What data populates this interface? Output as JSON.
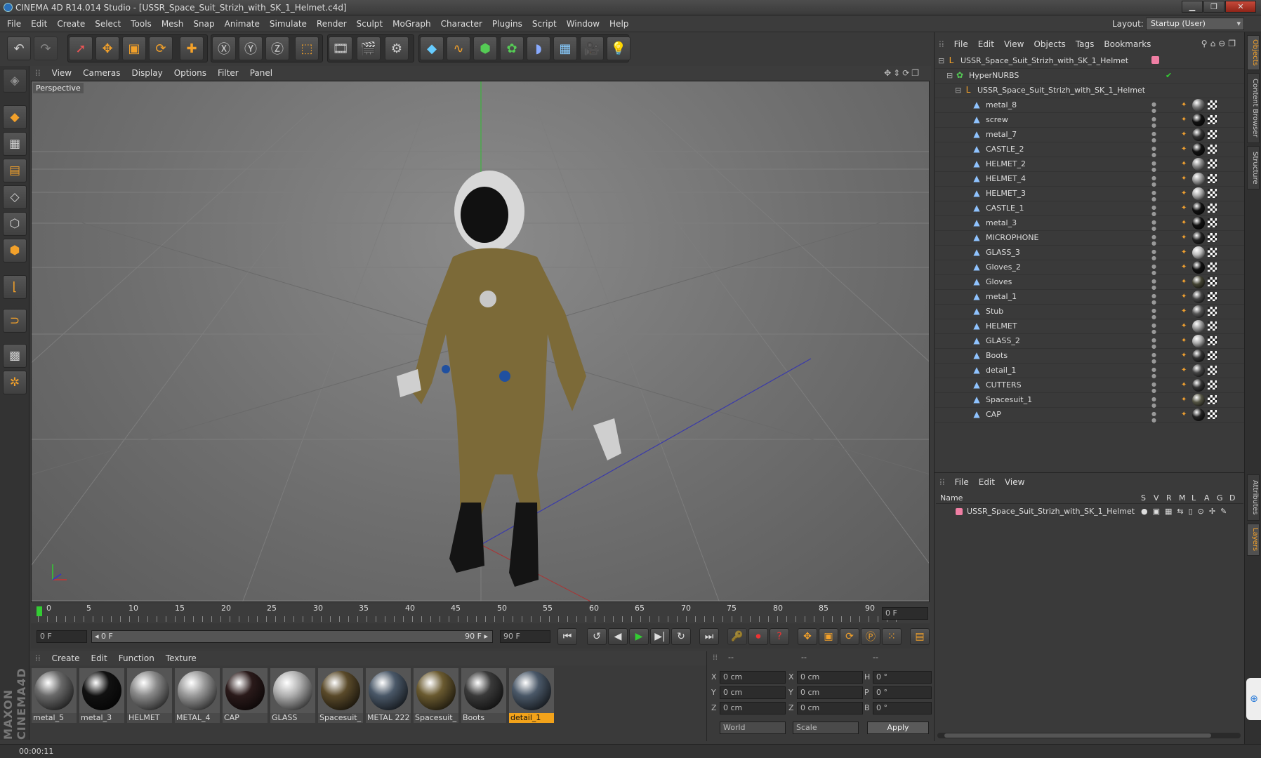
{
  "window": {
    "title": "CINEMA 4D R14.014 Studio - [USSR_Space_Suit_Strizh_with_SK_1_Helmet.c4d]",
    "min": "▁",
    "max": "❐",
    "close": "✕"
  },
  "menubar": {
    "items": [
      "File",
      "Edit",
      "Create",
      "Select",
      "Tools",
      "Mesh",
      "Snap",
      "Animate",
      "Simulate",
      "Render",
      "Sculpt",
      "MoGraph",
      "Character",
      "Plugins",
      "Script",
      "Window",
      "Help"
    ],
    "layout_label": "Layout:",
    "layout_value": "Startup (User)"
  },
  "viewport": {
    "menu": [
      "View",
      "Cameras",
      "Display",
      "Options",
      "Filter",
      "Panel"
    ],
    "label": "Perspective"
  },
  "timeline": {
    "ticks": [
      "0",
      "5",
      "10",
      "15",
      "20",
      "25",
      "30",
      "35",
      "40",
      "45",
      "50",
      "55",
      "60",
      "65",
      "70",
      "75",
      "80",
      "85",
      "90"
    ],
    "frame_right": "0 F",
    "start": "0 F",
    "range_start": "◂ 0 F",
    "range_end": "90 F ▸",
    "end": "90 F"
  },
  "materials": {
    "menu": [
      "Create",
      "Edit",
      "Function",
      "Texture"
    ],
    "items": [
      {
        "name": "metal_5",
        "color": "#6a6a6a"
      },
      {
        "name": "metal_3",
        "color": "#111111"
      },
      {
        "name": "HELMET",
        "color": "#8a8a8a"
      },
      {
        "name": "METAL_4",
        "color": "#9a9a9a"
      },
      {
        "name": "CAP",
        "color": "#2a1a1a"
      },
      {
        "name": "GLASS",
        "color": "#b0b0b0"
      },
      {
        "name": "Spacesuit_",
        "color": "#5a4a2a"
      },
      {
        "name": "METAL 222",
        "color": "#4a5868"
      },
      {
        "name": "Spacesuit_",
        "color": "#6a5a30"
      },
      {
        "name": "Boots",
        "color": "#3a3a3a"
      },
      {
        "name": "detail_1",
        "color": "#4a5868"
      }
    ]
  },
  "coords": {
    "header1": "--",
    "header2": "--",
    "header3": "--",
    "x1": "0 cm",
    "y1": "0 cm",
    "z1": "0 cm",
    "x2": "0 cm",
    "y2": "0 cm",
    "z2": "0 cm",
    "h": "0 °",
    "p": "0 °",
    "b": "0 °",
    "lx": "X",
    "ly": "Y",
    "lz": "Z",
    "lx2": "X",
    "ly2": "Y",
    "lz2": "Z",
    "lh": "H",
    "lp": "P",
    "lb": "B",
    "world": "World",
    "scale": "Scale",
    "apply": "Apply"
  },
  "objects": {
    "menu": [
      "File",
      "Edit",
      "View",
      "Objects",
      "Tags",
      "Bookmarks"
    ],
    "root": "USSR_Space_Suit_Strizh_with_SK_1_Helmet",
    "hypernurbs": "HyperNURBS",
    "group": "USSR_Space_Suit_Strizh_with_SK_1_Helmet",
    "children": [
      "metal_8",
      "screw",
      "metal_7",
      "CASTLE_2",
      "HELMET_2",
      "HELMET_4",
      "HELMET_3",
      "CASTLE_1",
      "metal_3",
      "MICROPHONE",
      "GLASS_3",
      "Gloves_2",
      "Gloves",
      "metal_1",
      "Stub",
      "HELMET",
      "GLASS_2",
      "Boots",
      "detail_1",
      "CUTTERS",
      "Spacesuit_1",
      "CAP"
    ]
  },
  "layers": {
    "menu": [
      "File",
      "Edit",
      "View"
    ],
    "col_name": "Name",
    "cols": [
      "S",
      "V",
      "R",
      "M",
      "L",
      "A",
      "G",
      "D"
    ],
    "row": "USSR_Space_Suit_Strizh_with_SK_1_Helmet"
  },
  "side_tabs": [
    "Objects",
    "Content Browser",
    "Structure",
    "Attributes",
    "Layers"
  ],
  "status": {
    "time": "00:00:11"
  },
  "brand": "MAXON CINEMA4D"
}
